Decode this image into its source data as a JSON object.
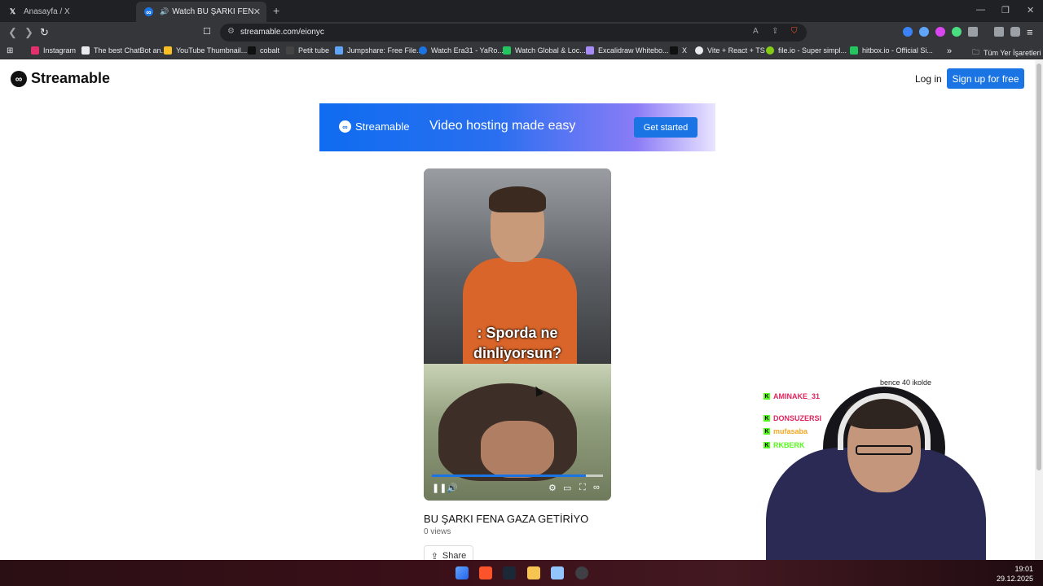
{
  "browser": {
    "tabs": [
      {
        "title": "Anasayfa / X",
        "active": false
      },
      {
        "title": "Watch BU ŞARKI FENA GAZA",
        "active": true
      }
    ],
    "url": "streamable.com/eionyc",
    "bookmarks": [
      "Instagram",
      "The best ChatBot an...",
      "YouTube Thumbnail...",
      "cobalt",
      "Petit tube",
      "Jumpshare: Free File...",
      "Watch Era31 - YaRo...",
      "Watch Global & Loc...",
      "Excalidraw Whitebo...",
      "X",
      "Vite + React + TS",
      "file.io - Super simpl...",
      "hitbox.io - Official Si..."
    ],
    "all_bookmarks": "Tüm Yer İşaretleri"
  },
  "site": {
    "logo": "Streamable",
    "login": "Log in",
    "signup": "Sign up for free"
  },
  "banner": {
    "logo": "Streamable",
    "tagline": "Video hosting made easy",
    "cta": "Get started"
  },
  "video": {
    "caption_line1": ": Sporda ne",
    "caption_line2": "dinliyorsun?",
    "title": "BU ŞARKI FENA GAZA GETİRİYO",
    "views": "0 views",
    "share": "Share",
    "progress_fraction": 0.9
  },
  "overlay": {
    "chat": [
      {
        "user": "AMINAKE_31",
        "color": "#e0245e"
      },
      {
        "user": "DONSUZERSI",
        "color": "#e0245e"
      },
      {
        "user": "mufasaba",
        "color": "#f5a623"
      },
      {
        "user": "RKBERK",
        "color": "#53fc18"
      }
    ],
    "message_1": "bence 40 ikolde"
  },
  "taskbar": {
    "time": "19:01",
    "date": "29.12.2025"
  }
}
